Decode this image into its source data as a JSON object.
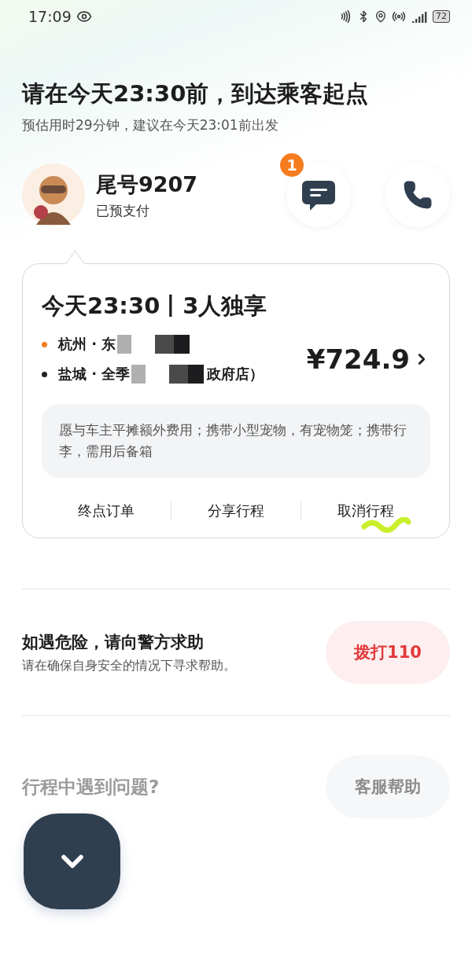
{
  "status_bar": {
    "time": "17:09",
    "battery": "72"
  },
  "header": {
    "title": "请在今天23:30前，到达乘客起点",
    "subtitle": "预估用时29分钟，建议在今天23:01前出发"
  },
  "driver": {
    "name": "尾号9207",
    "payment_status": "已预支付",
    "message_badge": "1"
  },
  "order": {
    "title": "今天23:30丨3人独享",
    "stops": [
      {
        "text": "杭州 · 东",
        "redacted": true,
        "color": "#f57c1f"
      },
      {
        "text": "盐城 · 全季",
        "redacted": true,
        "after": "政府店）",
        "color": "#222222"
      }
    ],
    "price": "¥724.9",
    "note": "愿与车主平摊额外费用；携带小型宠物，有宠物笼；携带行李，需用后备箱",
    "actions": [
      "终点订单",
      "分享行程",
      "取消行程"
    ]
  },
  "safety": {
    "title": "如遇危险，请向警方求助",
    "subtitle": "请在确保自身安全的情况下寻求帮助。",
    "button": "拨打110"
  },
  "help": {
    "title": "行程中遇到问题?",
    "button": "客服帮助"
  }
}
